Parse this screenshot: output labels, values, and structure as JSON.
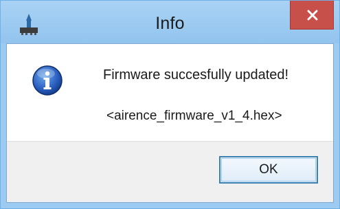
{
  "window": {
    "title": "Info",
    "app_icon": "rocket-app-icon",
    "close_icon": "close-icon"
  },
  "dialog": {
    "icon": "info-icon",
    "message": "Firmware succesfully updated!",
    "filename": "<airence_firmware_v1_4.hex>"
  },
  "buttons": {
    "ok_label": "OK"
  },
  "colors": {
    "titlebar": "#9ccaf0",
    "close_button": "#c7504a",
    "footer": "#f0f0f0",
    "ok_border": "#3c7fb1"
  }
}
